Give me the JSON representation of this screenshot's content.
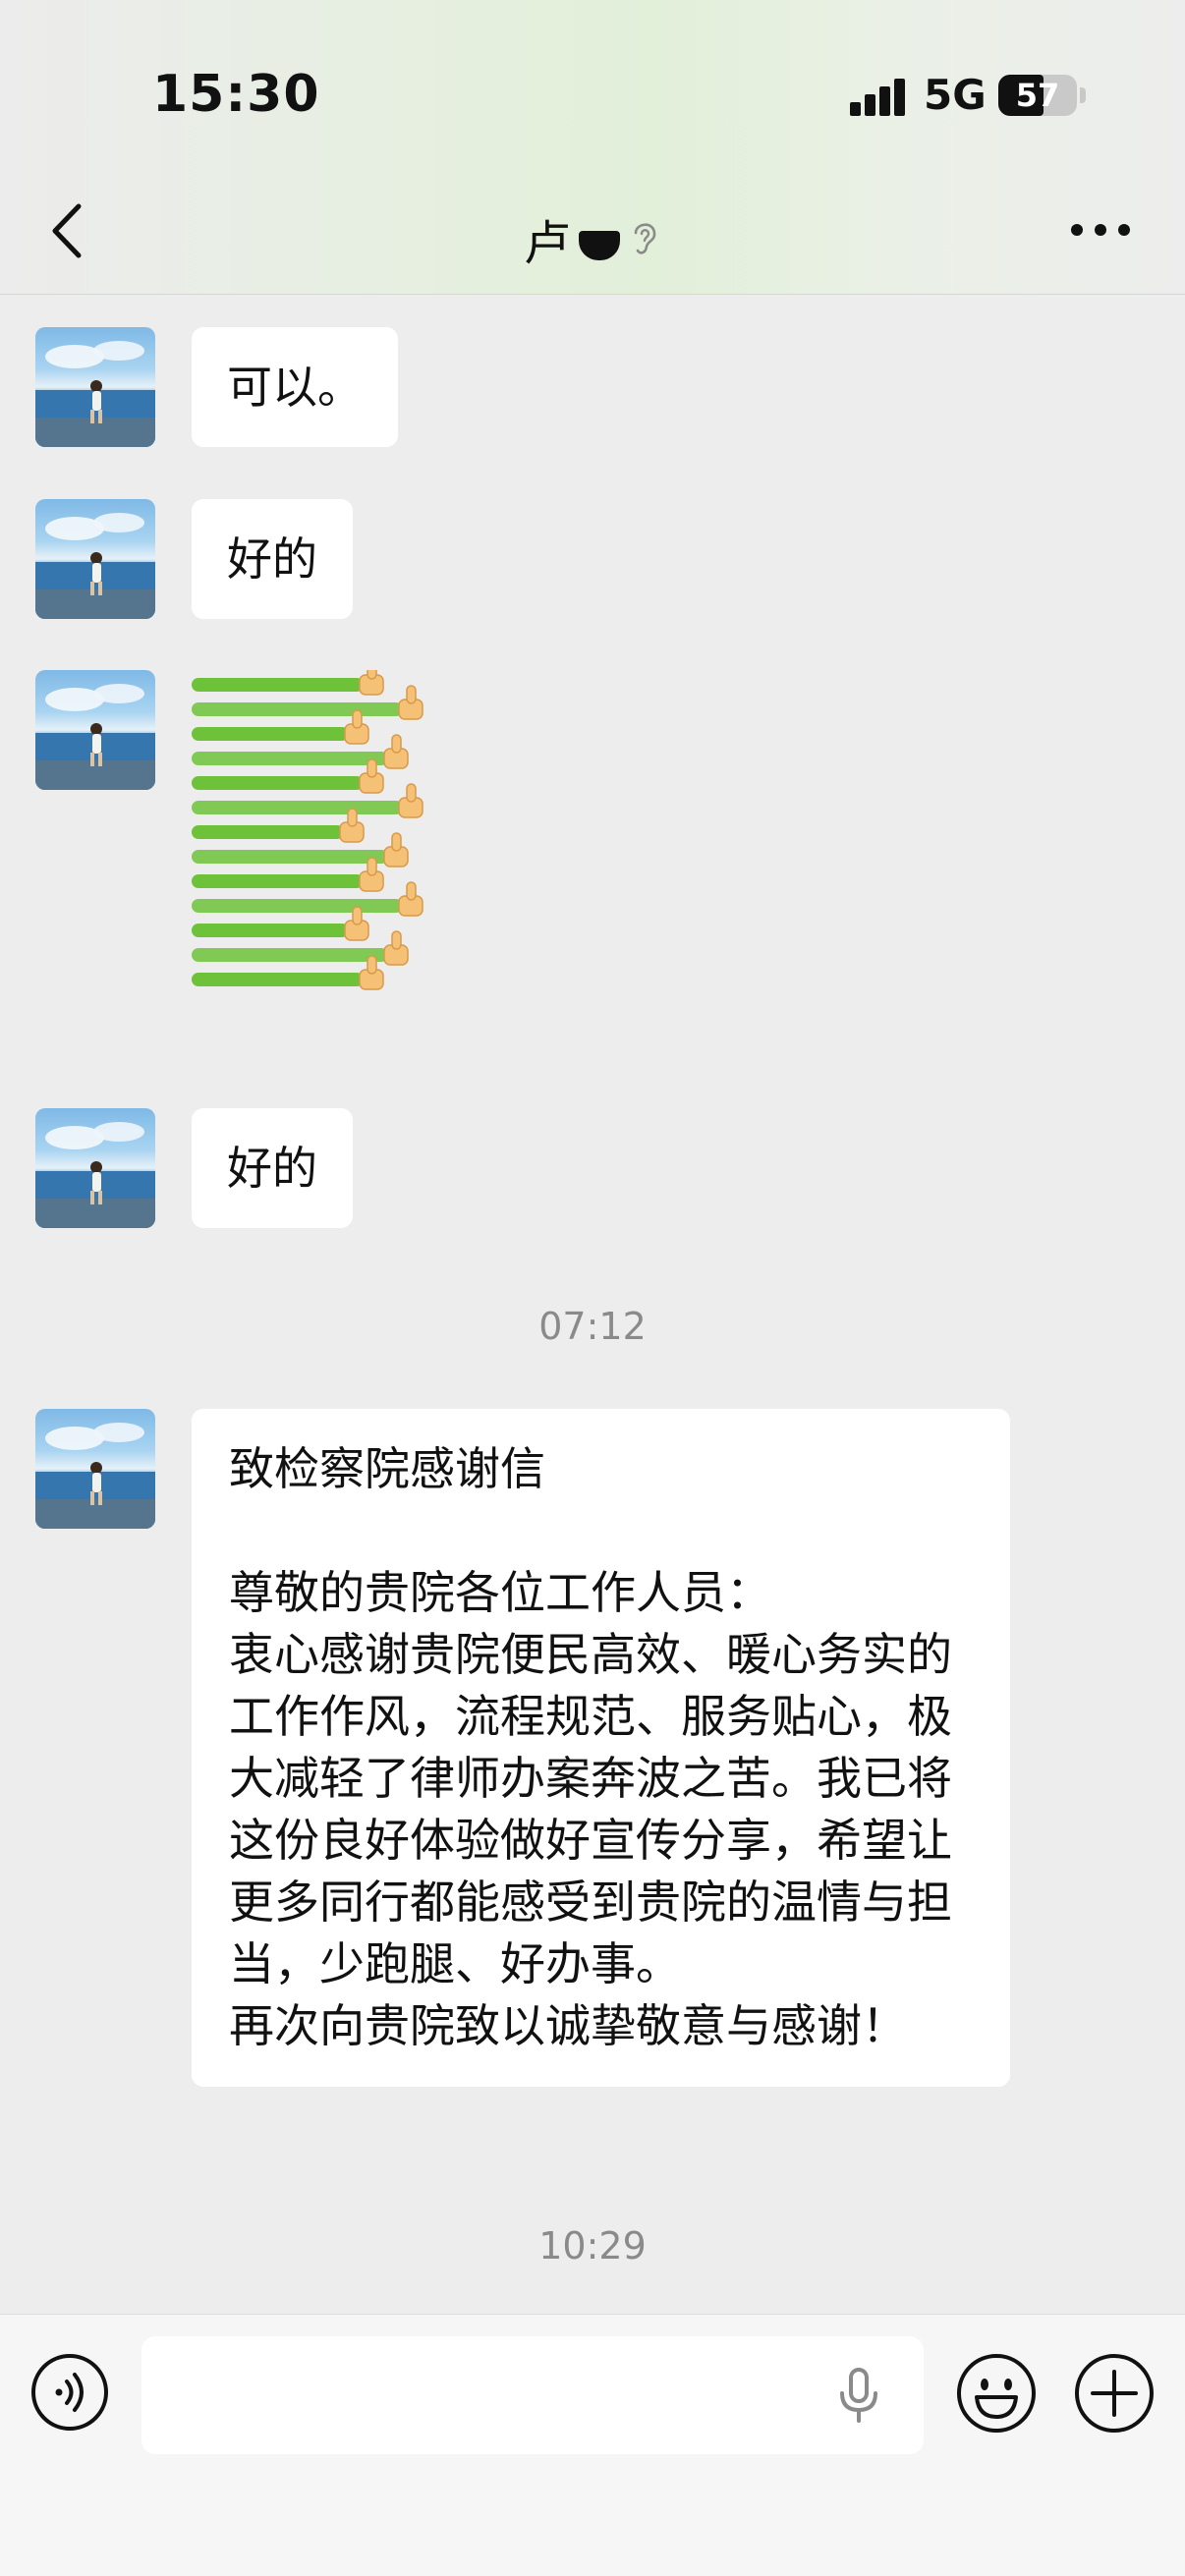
{
  "status_bar": {
    "time": "15:30",
    "network": "5G",
    "battery": "57",
    "battery_level_percent": 57
  },
  "nav": {
    "title": "卢",
    "back_icon": "chevron-left-icon",
    "more_icon": "more-horizontal-icon",
    "ear_icon": "ear-icon"
  },
  "messages": [
    {
      "type": "text",
      "text": "可以。"
    },
    {
      "type": "text",
      "text": "好的"
    },
    {
      "type": "sticker",
      "sticker_name": "thumbs-up-stack-sticker"
    },
    {
      "type": "text",
      "text": "好的"
    },
    {
      "type": "timestamp",
      "text": "07:12"
    },
    {
      "type": "text",
      "text": "致检察院感谢信\n\n尊敬的贵院各位工作人员：\n衷心感谢贵院便民高效、暖心务实的工作作风，流程规范、服务贴心，极大减轻了律师办案奔波之苦。我已将这份良好体验做好宣传分享，希望让更多同行都能感受到贵院的温情与担当，少跑腿、好办事。\n再次向贵院致以诚挚敬意与感谢！"
    },
    {
      "type": "timestamp",
      "text": "10:29"
    }
  ],
  "input_bar": {
    "voice_icon": "voice-mode-icon",
    "mic_icon": "microphone-icon",
    "emoji_icon": "smiley-icon",
    "plus_icon": "plus-circle-icon",
    "placeholder": ""
  },
  "colors": {
    "background": "#ededed",
    "bubble": "#ffffff",
    "timestamp": "#8a8a8a",
    "header_tint": "#e2efd9",
    "sticker_green": "#6dc23a",
    "thumb_skin": "#f5c177"
  }
}
